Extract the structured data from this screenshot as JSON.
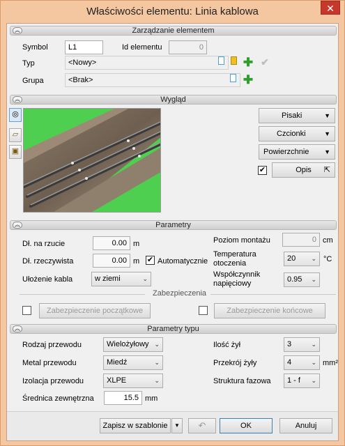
{
  "window": {
    "title": "Właściwości elementu: Linia kablowa",
    "close": "✕"
  },
  "sections": {
    "management": "Zarządzanie elementem",
    "appearance": "Wygląd",
    "parameters": "Parametry",
    "protection": "Zabezpieczenia",
    "type_parameters": "Parametry typu"
  },
  "management": {
    "symbol_label": "Symbol",
    "symbol_value": "L1",
    "id_label": "Id elementu",
    "id_value": "0",
    "type_label": "Typ",
    "type_value": "<Nowy>",
    "group_label": "Grupa",
    "group_value": "<Brak>"
  },
  "appearance": {
    "pens": "Pisaki",
    "fonts": "Czcionki",
    "surfaces": "Powierzchnie",
    "description": "Opis",
    "description_checked": true,
    "side_icons": [
      "camera-icon",
      "folder-icon",
      "cube-icon"
    ]
  },
  "parameters": {
    "proj_len_label": "Dł. na rzucie",
    "proj_len_value": "0.00",
    "proj_len_unit": "m",
    "real_len_label": "Dł. rzeczywista",
    "real_len_value": "0.00",
    "real_len_unit": "m",
    "auto_label": "Automatycznie",
    "auto_checked": true,
    "laying_label": "Ułożenie kabla",
    "laying_value": "w ziemi",
    "mount_label": "Poziom montażu",
    "mount_value": "0",
    "mount_unit": "cm",
    "temp_label_1": "Temperatura",
    "temp_label_2": "otoczenia",
    "temp_value": "20",
    "temp_unit": "°C",
    "coef_label_1": "Współczynnik",
    "coef_label_2": "napięciowy",
    "coef_value": "0.95"
  },
  "protection": {
    "start": "Zabezpieczenie początkowe",
    "end": "Zabezpieczenie końcowe"
  },
  "type_params": {
    "conductor_label": "Rodzaj przewodu",
    "conductor_value": "Wielożyłowy",
    "metal_label": "Metal przewodu",
    "metal_value": "Miedź",
    "insulation_label": "Izolacja przewodu",
    "insulation_value": "XLPE",
    "diameter_label": "Średnica zewnętrzna",
    "diameter_value": "15.5",
    "diameter_unit": "mm",
    "cores_label": "Ilość żył",
    "cores_value": "3",
    "section_label": "Przekrój żyły",
    "section_value": "4",
    "section_unit": "mm²",
    "phase_label": "Struktura fazowa",
    "phase_value": "1 - f"
  },
  "footer": {
    "save_template": "Zapisz w szablonie",
    "ok": "OK",
    "cancel": "Anuluj"
  }
}
